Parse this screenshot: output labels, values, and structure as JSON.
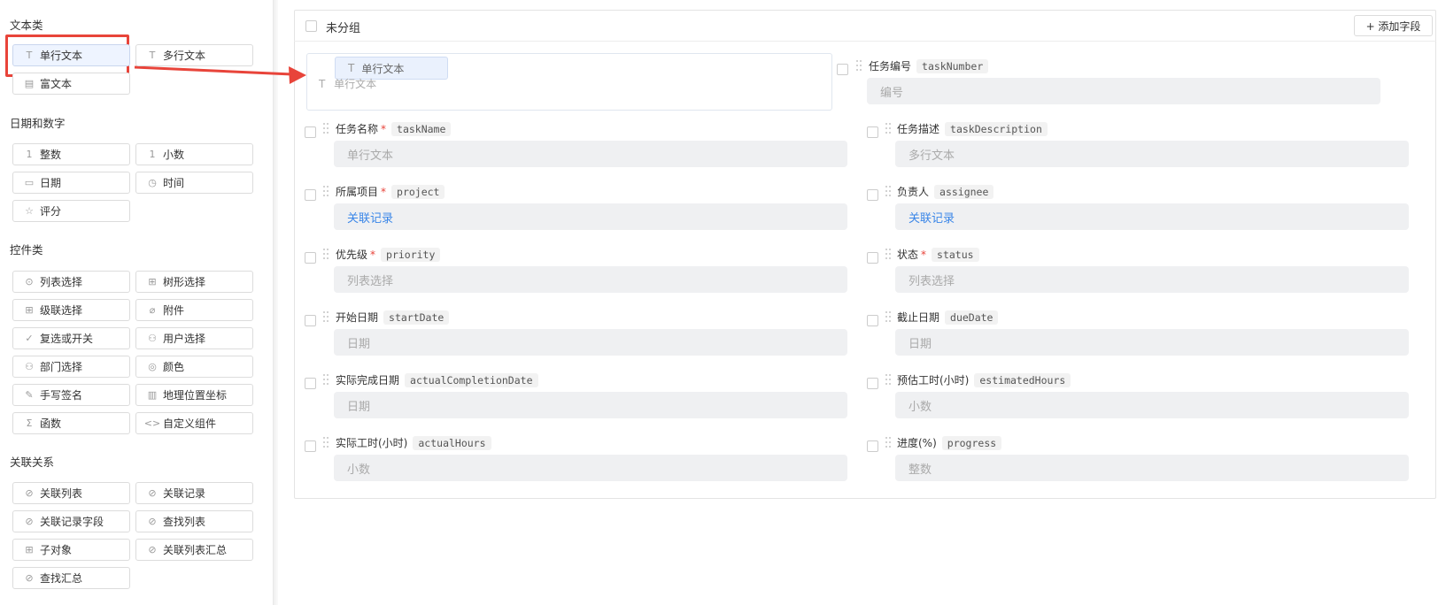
{
  "palette": {
    "sections": [
      {
        "title": "文本类",
        "items": [
          {
            "label": "单行文本",
            "icon": "text-t-icon",
            "glyph": "T"
          },
          {
            "label": "多行文本",
            "icon": "text-t-icon",
            "glyph": "T"
          },
          {
            "label": "富文本",
            "icon": "document-icon",
            "glyph": "▤"
          }
        ]
      },
      {
        "title": "日期和数字",
        "items": [
          {
            "label": "整数",
            "icon": "number-icon",
            "glyph": "1"
          },
          {
            "label": "小数",
            "icon": "number-icon",
            "glyph": "1"
          },
          {
            "label": "日期",
            "icon": "calendar-icon",
            "glyph": "▭"
          },
          {
            "label": "时间",
            "icon": "clock-icon",
            "glyph": "◷"
          },
          {
            "label": "评分",
            "icon": "star-icon",
            "glyph": "☆"
          }
        ]
      },
      {
        "title": "控件类",
        "items": [
          {
            "label": "列表选择",
            "icon": "check-circle-icon",
            "glyph": "⊙"
          },
          {
            "label": "树形选择",
            "icon": "tree-icon",
            "glyph": "⊞"
          },
          {
            "label": "级联选择",
            "icon": "cascade-icon",
            "glyph": "⊞"
          },
          {
            "label": "附件",
            "icon": "paperclip-icon",
            "glyph": "⌀"
          },
          {
            "label": "复选或开关",
            "icon": "checkmark-icon",
            "glyph": "✓"
          },
          {
            "label": "用户选择",
            "icon": "user-icon",
            "glyph": "⚇"
          },
          {
            "label": "部门选择",
            "icon": "department-icon",
            "glyph": "⚇"
          },
          {
            "label": "颜色",
            "icon": "palette-icon",
            "glyph": "◎"
          },
          {
            "label": "手写签名",
            "icon": "pen-icon",
            "glyph": "✎"
          },
          {
            "label": "地理位置坐标",
            "icon": "map-icon",
            "glyph": "▥"
          },
          {
            "label": "函数",
            "icon": "sigma-icon",
            "glyph": "Σ"
          },
          {
            "label": "自定义组件",
            "icon": "code-icon",
            "glyph": "<>"
          }
        ]
      },
      {
        "title": "关联关系",
        "items": [
          {
            "label": "关联列表",
            "icon": "link-icon",
            "glyph": "⊘"
          },
          {
            "label": "关联记录",
            "icon": "link-icon",
            "glyph": "⊘"
          },
          {
            "label": "关联记录字段",
            "icon": "link-icon",
            "glyph": "⊘"
          },
          {
            "label": "查找列表",
            "icon": "link-icon",
            "glyph": "⊘"
          },
          {
            "label": "子对象",
            "icon": "sub-object-icon",
            "glyph": "⊞"
          },
          {
            "label": "关联列表汇总",
            "icon": "link-icon",
            "glyph": "⊘"
          },
          {
            "label": "查找汇总",
            "icon": "link-icon",
            "glyph": "⊘"
          }
        ]
      }
    ]
  },
  "colors": {
    "highlight": "#e8443a",
    "accent": "#3a86e8",
    "required": "#e8443a",
    "input_bg": "#eff0f2"
  },
  "canvas": {
    "group_title": "未分组",
    "add_field_label": "+ 添加字段",
    "drag_ghost": {
      "label": "单行文本",
      "glyph": "T"
    },
    "drop_placeholder": {
      "label": "单行文本",
      "glyph": "T"
    },
    "fields": [
      {
        "label": "任务编号",
        "code": "taskNumber",
        "required": false,
        "placeholder": "编号",
        "type": "text"
      },
      {
        "label": "任务名称",
        "code": "taskName",
        "required": true,
        "placeholder": "单行文本",
        "type": "text"
      },
      {
        "label": "任务描述",
        "code": "taskDescription",
        "required": false,
        "placeholder": "多行文本",
        "type": "text"
      },
      {
        "label": "所属项目",
        "code": "project",
        "required": true,
        "placeholder": "关联记录",
        "type": "link"
      },
      {
        "label": "负责人",
        "code": "assignee",
        "required": false,
        "placeholder": "关联记录",
        "type": "link"
      },
      {
        "label": "优先级",
        "code": "priority",
        "required": true,
        "placeholder": "列表选择",
        "type": "text"
      },
      {
        "label": "状态",
        "code": "status",
        "required": true,
        "placeholder": "列表选择",
        "type": "text"
      },
      {
        "label": "开始日期",
        "code": "startDate",
        "required": false,
        "placeholder": "日期",
        "type": "text"
      },
      {
        "label": "截止日期",
        "code": "dueDate",
        "required": false,
        "placeholder": "日期",
        "type": "text"
      },
      {
        "label": "实际完成日期",
        "code": "actualCompletionDate",
        "required": false,
        "placeholder": "日期",
        "type": "text"
      },
      {
        "label": "预估工时(小时)",
        "code": "estimatedHours",
        "required": false,
        "placeholder": "小数",
        "type": "text"
      },
      {
        "label": "实际工时(小时)",
        "code": "actualHours",
        "required": false,
        "placeholder": "小数",
        "type": "text"
      },
      {
        "label": "进度(%)",
        "code": "progress",
        "required": false,
        "placeholder": "整数",
        "type": "text"
      }
    ]
  }
}
